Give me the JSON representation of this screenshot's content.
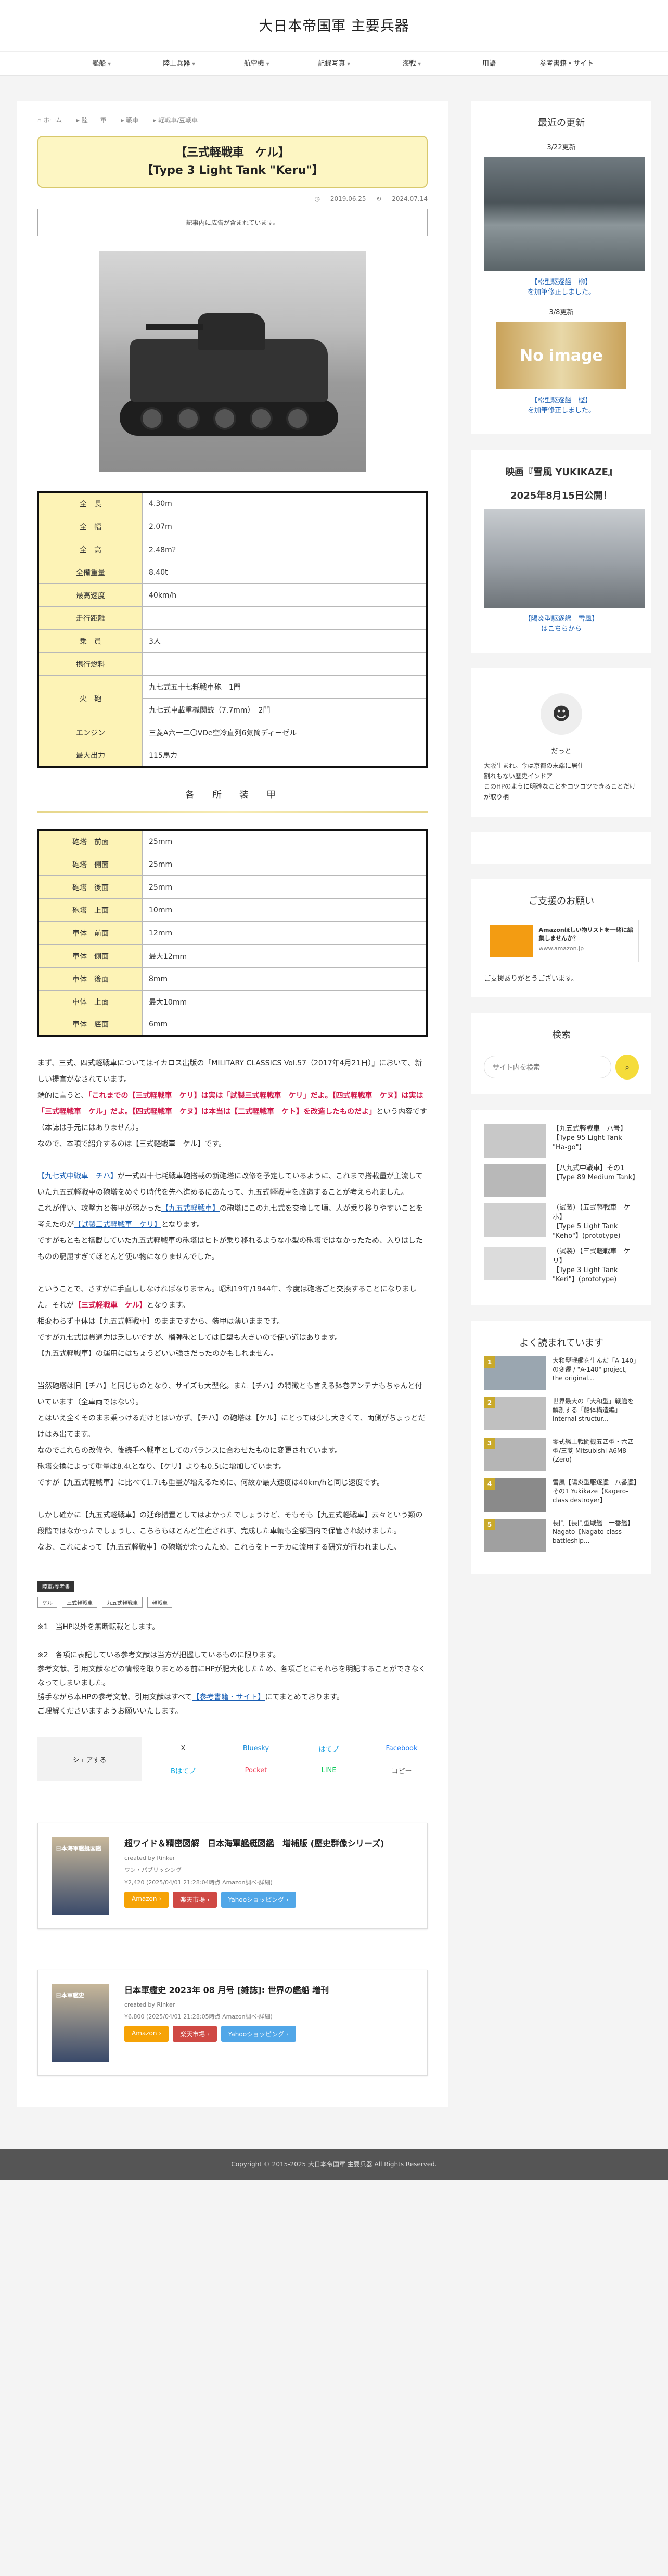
{
  "site": {
    "title": "大日本帝国軍 主要兵器"
  },
  "nav": [
    {
      "label": "艦船",
      "caret": "▾"
    },
    {
      "label": "陸上兵器",
      "caret": "▾"
    },
    {
      "label": "航空機",
      "caret": "▾"
    },
    {
      "label": "記録写真",
      "caret": "▾"
    },
    {
      "label": "海戦",
      "caret": "▾"
    },
    {
      "label": "用語",
      "caret": ""
    },
    {
      "label": "参考書籍・サイト",
      "caret": ""
    }
  ],
  "crumbs": [
    "ホーム",
    "陸　　軍",
    "戦車",
    "軽戦車/豆戦車"
  ],
  "article": {
    "title1": "【三式軽戦車　ケル】",
    "title2": "【Type 3 Light Tank \"Keru\"】",
    "published": "2019.06.25",
    "updated": "2024.07.14",
    "ad_note": "記事内に広告が含まれています。"
  },
  "specs": [
    {
      "k": "全　長",
      "v": "4.30m"
    },
    {
      "k": "全　幅",
      "v": "2.07m"
    },
    {
      "k": "全　高",
      "v": "2.48m？"
    },
    {
      "k": "全備重量",
      "v": "8.40t"
    },
    {
      "k": "最高速度",
      "v": "40km/h"
    },
    {
      "k": "走行距離",
      "v": ""
    },
    {
      "k": "乗　員",
      "v": "3人"
    },
    {
      "k": "携行燃料",
      "v": ""
    },
    {
      "k": "火　砲",
      "v": "九七式五十七粍戦車砲　1門",
      "v2": "九七式車載重機関銃（7.7mm）　2門"
    },
    {
      "k": "エンジン",
      "v": "三菱A六一二〇VDe空冷直列6気筒ディーゼル"
    },
    {
      "k": "最大出力",
      "v": "115馬力"
    }
  ],
  "armor_heading": "各　所　装　甲",
  "armor": [
    {
      "k": "砲塔　前面",
      "v": "25mm"
    },
    {
      "k": "砲塔　側面",
      "v": "25mm"
    },
    {
      "k": "砲塔　後面",
      "v": "25mm"
    },
    {
      "k": "砲塔　上面",
      "v": "10mm"
    },
    {
      "k": "車体　前面",
      "v": "12mm"
    },
    {
      "k": "車体　側面",
      "v": "最大12mm"
    },
    {
      "k": "車体　後面",
      "v": "8mm"
    },
    {
      "k": "車体　上面",
      "v": "最大10mm"
    },
    {
      "k": "車体　底面",
      "v": "6mm"
    }
  ],
  "prose": {
    "p1": "まず、三式、四式軽戦車についてはイカロス出版の「MILITARY CLASSICS Vol.57（2017年4月21日）」において、新しい提言がなされています。",
    "p2a": "端的に言うと、",
    "p2b": "「これまでの【三式軽戦車　ケリ】は実は「試製三式軽戦車　ケリ」だよ。【四式軽戦車　ケヌ】は実は「三式軽戦車　ケル」だよ。【四式軽戦車　ケヌ】は本当は【二式軽戦車　ケト】を改造したものだよ」",
    "p2c": "という内容です（本誌は手元にはありません）。",
    "p2d": "なので、本項で紹介するのは【三式軽戦車　ケル】です。",
    "p3a": "【九七式中戦車　チハ】",
    "p3b": "が一式四十七粍戦車砲搭載の新砲塔に改修を予定しているように、これまで搭載量が主流していた九五式軽戦車の砲塔をめぐり時代を先へ進めるにあたって、九五式軽戦車を改造することが考えられました。",
    "p3c": "これが伴い、攻撃力と装甲が弱かった",
    "p3d": "【九五式軽戦車】",
    "p3e": "の砲塔にこの九七式を交換して頃、人が乗り移りやすいことを考えたのが",
    "p3f": "【試製三式軽戦車　ケリ】",
    "p3g": "となります。",
    "p3h": "ですがもともと搭載していた九五式軽戦車の砲塔はヒトが乗り移れるような小型の砲塔ではなかったため、入りはしたものの窮屈すぎてほとんど使い物になりませんでした。",
    "p4a": "ということで、さすがに手直ししなければなりません。昭和19年/1944年、今度は砲塔ごと交換することになりました。それが",
    "p4b": "【三式軽戦車　ケル】",
    "p4c": "となります。",
    "p4d": "相変わらず車体は【九五式軽戦車】のままですから、装甲は薄いままです。",
    "p4e": "ですが九七式は貫通力は乏しいですが、榴弾砲としては旧型も大きいので使い道はあります。",
    "p4f": "【九五式軽戦車】の運用にはちょうどいい強さだったのかもしれません。",
    "p5a": "当然砲塔は旧【チハ】と同じものとなり、サイズも大型化。また【チハ】の特徴とも言える鉢巻アンテナもちゃんと付いています（全車両ではない）。",
    "p5b": "とはいえ全くそのまま乗っけるだけとはいかず、【チハ】の砲塔は【ケル】にとっては少し大きくて、両側がちょっとだけはみ出てます。",
    "p5c": "なのでこれらの改修や、後続手へ戦車としてのバランスに合わせたものに変更されています。",
    "p5d": "砲塔交換によって重量は8.4tとなり、【ケリ】よりも0.5tに増加しています。",
    "p5e": "ですが【九五式軽戦車】に比べて1.7tも重量が増えるために、何故か最大速度は40km/hと同じ速度です。",
    "p6a": "しかし確かに【九五式軽戦車】の延命措置としてはよかったでしょうけど、そもそも【九五式軽戦車】云々という類の段階ではなかったでしょうし、こちらもほとんど生産されず、完成した車輌も全部国内で保管され続けました。",
    "p6b": "なお、これによって【九五式軽戦車】の砲塔が余ったため、これらをトーチカに流用する研究が行われました。"
  },
  "tags": {
    "cat": "陸軍/参考書",
    "items": [
      "ケル",
      "三式軽戦車",
      "九五式軽戦車",
      "軽戦車"
    ]
  },
  "notes": {
    "n1": "※1　当HP以外を無断転載とします。",
    "n2": "※2　各項に表記している参考文献は当方が把握しているものに限ります。",
    "n3": "参考文献、引用文献などの情報を取りまとめる前にHPが肥大化したため、各項ごとにそれらを明記することができなくなってしまいました。",
    "n4a": "勝手ながら本HPの参考文献、引用文献はすべて",
    "n4b": "【参考書籍・サイト】",
    "n4c": "にてまとめております。",
    "n5": "ご理解くださいますようお願いいたします。"
  },
  "share": {
    "label": "シェアする",
    "buttons": [
      "X",
      "Bluesky",
      "はてブ",
      "Facebook",
      "Bはてブ",
      "Pocket",
      "LINE",
      "コピー"
    ]
  },
  "products": [
    {
      "title": "超ワイド＆精密図解　日本海軍艦艇図鑑　増補版 (歴史群像シリーズ)",
      "by": "created by Rinker",
      "pub": "ワン・パブリッシング",
      "price": "¥2,420 (2025/04/01 21:28:04時点 Amazon調べ-詳細)",
      "btns": [
        "Amazon ›",
        "楽天市場 ›",
        "Yahooショッピング ›"
      ],
      "img": "日本海軍艦艇図鑑"
    },
    {
      "title": "日本軍艦史 2023年 08 月号 [雑誌]: 世界の艦船 増刊",
      "by": "created by Rinker",
      "pub": "",
      "price": "¥6,800 (2025/04/01 21:28:05時点 Amazon調べ-詳細)",
      "btns": [
        "Amazon ›",
        "楽天市場 ›",
        "Yahooショッピング ›"
      ],
      "img": "日本軍艦史"
    }
  ],
  "side": {
    "recent_title": "最近の更新",
    "r1_date": "3/22更新",
    "r1_link": "【松型駆逐艦　柳】",
    "r1_more": "を加筆修正しました。",
    "r2_date": "3/8更新",
    "r2_img": "No image",
    "r2_link": "【松型駆逐艦　樫】",
    "r2_more": "を加筆修正しました。",
    "movie_title1": "映画『雪風 YUKIKAZE』",
    "movie_title2": "2025年8月15日公開！",
    "movie_link": "【陽炎型駆逐艦　雪風】",
    "movie_more": "はこちらから",
    "profile_name": "だっと",
    "profile_text": "大阪生まれ。今は京都の末端に居住\n割れもない歴史インドア\nこのHPのように明確なことをコツコツできることだけが取り柄",
    "support_title": "ご支援のお願い",
    "support_ad": "Amazonほしい物リストを一緒に編集しませんか？",
    "support_ad_url": "www.amazon.jp",
    "support_text": "ご支援ありがとうございます。",
    "search_title": "検索",
    "search_placeholder": "サイト内を検索",
    "tanks": [
      {
        "label": "【九五式軽戦車　ハ号】\n【Type 95 Light Tank \"Ha-go\"】"
      },
      {
        "label": "【八九式中戦車】その1\n【Type 89 Medium Tank】"
      },
      {
        "label": "（試製）【五式軽戦車　ケホ】\n【Type 5 Light Tank \"Keho\"】(prototype)"
      },
      {
        "label": "（試製）【三式軽戦車　ケリ】\n【Type 3 Light Tank \"Keri\"】(prototype)"
      }
    ],
    "popular_title": "よく読まれています",
    "popular": [
      {
        "label": "大和型戦艦を生んだ「A-140」の変遷 / \"A-140\" project, the original..."
      },
      {
        "label": "世界最大の「大和型」戦艦を解剖する「船体構造編」Internal structur..."
      },
      {
        "label": "零式艦上戦闘機五四型・六四型/三菱 Mitsubishi A6M8 (Zero)"
      },
      {
        "label": "雪風【陽炎型駆逐艦　八番艦】その1 Yukikaze【Kagero-class destroyer】"
      },
      {
        "label": "長門【長門型戦艦　一番艦】Nagato【Nagato-class battleship..."
      }
    ]
  },
  "footer": "Copyright © 2015-2025 大日本帝国軍 主要兵器 All Rights Reserved.",
  "colors": {
    "accent": "#d11a4b",
    "link": "#1a5fb4",
    "spec_key": "#fdf3b6",
    "title_bg": "#fdf6c3"
  }
}
